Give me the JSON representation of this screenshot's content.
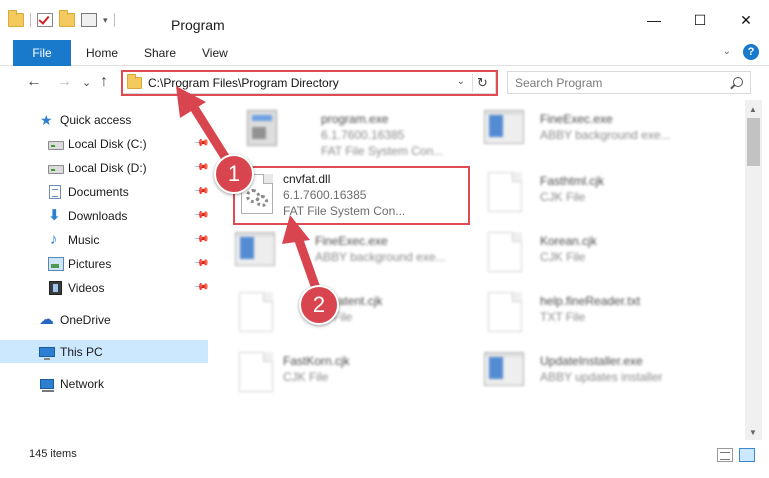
{
  "window": {
    "title": "Program",
    "controls": {
      "minimize": "—",
      "maximize": "☐",
      "close": "✕"
    }
  },
  "quick_access_toolbar": {
    "dropdown": "▾"
  },
  "ribbon": {
    "file_tab": "File",
    "tabs": [
      "Home",
      "Share",
      "View"
    ],
    "expand": "⌄",
    "help": "?"
  },
  "navbar": {
    "back": "←",
    "forward": "→",
    "recent": "⌄",
    "up": "↑",
    "address": "C:\\Program Files\\Program Directory",
    "address_dropdown": "⌄",
    "refresh": "↻",
    "search_placeholder": "Search Program"
  },
  "sidebar": {
    "items": [
      {
        "label": "Quick access",
        "icon": "star-icon",
        "glyph": "★",
        "pinned": false
      },
      {
        "label": "Local Disk (C:)",
        "icon": "disk-icon",
        "glyph": "",
        "pinned": true
      },
      {
        "label": "Local Disk (D:)",
        "icon": "disk-icon",
        "glyph": "",
        "pinned": true
      },
      {
        "label": "Documents",
        "icon": "document-icon",
        "glyph": "",
        "pinned": true
      },
      {
        "label": "Downloads",
        "icon": "download-icon",
        "glyph": "⬇",
        "pinned": true
      },
      {
        "label": "Music",
        "icon": "music-icon",
        "glyph": "♪",
        "pinned": true
      },
      {
        "label": "Pictures",
        "icon": "pictures-icon",
        "glyph": "",
        "pinned": true
      },
      {
        "label": "Videos",
        "icon": "videos-icon",
        "glyph": "",
        "pinned": true
      },
      {
        "label": "OneDrive",
        "icon": "cloud-icon",
        "glyph": "☁",
        "pinned": false
      },
      {
        "label": "This PC",
        "icon": "computer-icon",
        "glyph": "",
        "pinned": false,
        "selected": true
      },
      {
        "label": "Network",
        "icon": "network-icon",
        "glyph": "",
        "pinned": false
      }
    ],
    "pin_glyph": "📌"
  },
  "files": [
    {
      "name": "program.exe",
      "line2": "6.1.7600.16385",
      "line3": "FAT File System Con...",
      "icon": "setup-icon",
      "blurred": true
    },
    {
      "name": "FineExec.exe",
      "line2": "ABBY background exe...",
      "line3": "",
      "icon": "exe-icon",
      "blurred": true
    },
    {
      "name": "cnvfat.dll",
      "line2": "6.1.7600.16385",
      "line3": "FAT File System Con...",
      "icon": "dll-gear-icon",
      "blurred": false
    },
    {
      "name": "Fasthtml.cjk",
      "line2": "CJK File",
      "line3": "",
      "icon": "document-icon",
      "blurred": true
    },
    {
      "name": "FineExec.exe",
      "line2": "ABBY background exe...",
      "line3": "",
      "icon": "exe-icon",
      "blurred": true
    },
    {
      "name": "Korean.cjk",
      "line2": "CJK File",
      "line3": "",
      "icon": "document-icon",
      "blurred": true
    },
    {
      "name": "Dedicatent.cjk",
      "line2": "CJK File",
      "line3": "",
      "icon": "document-icon",
      "blurred": true
    },
    {
      "name": "help.fineReader.txt",
      "line2": "TXT File",
      "line3": "",
      "icon": "document-icon",
      "blurred": true
    },
    {
      "name": "FastKorn.cjk",
      "line2": "CJK File",
      "line3": "",
      "icon": "document-icon",
      "blurred": true
    },
    {
      "name": "UpdateInstaller.exe",
      "line2": "ABBY updates installer",
      "line3": "",
      "icon": "exe-icon",
      "blurred": true
    }
  ],
  "scrollbar": {
    "up": "▲",
    "down": "▼"
  },
  "status": {
    "item_count": "145 items"
  },
  "callouts": [
    {
      "label": "1"
    },
    {
      "label": "2"
    }
  ],
  "colors": {
    "accent": "#1979ca",
    "selection": "#cce8ff",
    "callout": "#d9454e",
    "highlight_border": "#e04a52"
  }
}
